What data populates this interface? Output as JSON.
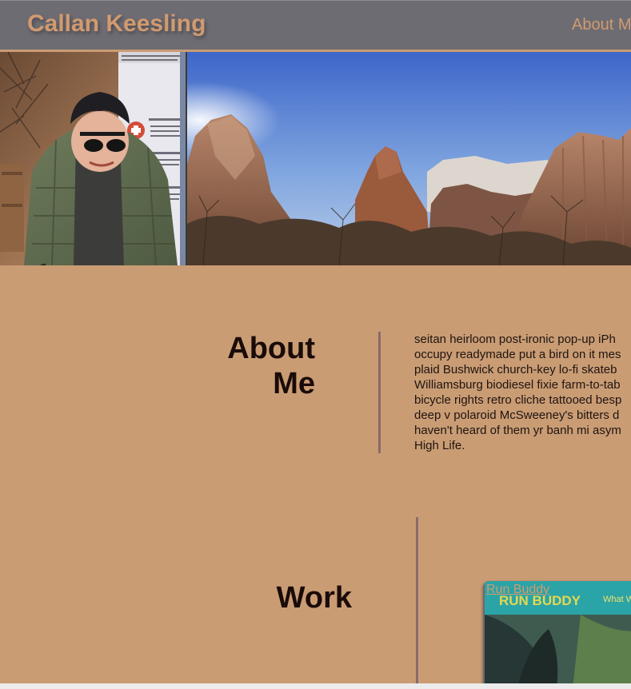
{
  "header": {
    "title": "Callan Keesling",
    "nav_about": "About M"
  },
  "hero": {
    "portrait_alt": "photo of person with bicycle helmet and sunglasses",
    "landscape_alt": "canyon landscape"
  },
  "about": {
    "heading_line1": "About",
    "heading_line2": "Me",
    "lines": [
      "seitan heirloom post-ironic pop-up iPh",
      "occupy readymade put a bird on it mes",
      "plaid Bushwick church-key lo-fi skateb",
      "Williamsburg biodiesel fixie farm-to-tab",
      "bicycle rights retro cliche tattooed besp",
      "deep v polaroid McSweeney's bitters d",
      "haven't heard of them yr banh mi asym",
      "High Life."
    ]
  },
  "work": {
    "heading": "Work",
    "project_label": "Run Buddy",
    "project_banner": "RUN BUDDY",
    "project_banner_right": "What W"
  },
  "colors": {
    "page_bg": "#c99c74",
    "header_bg": "#6e6c73",
    "accent": "#d19a6f",
    "divider": "#8a6a6e"
  }
}
